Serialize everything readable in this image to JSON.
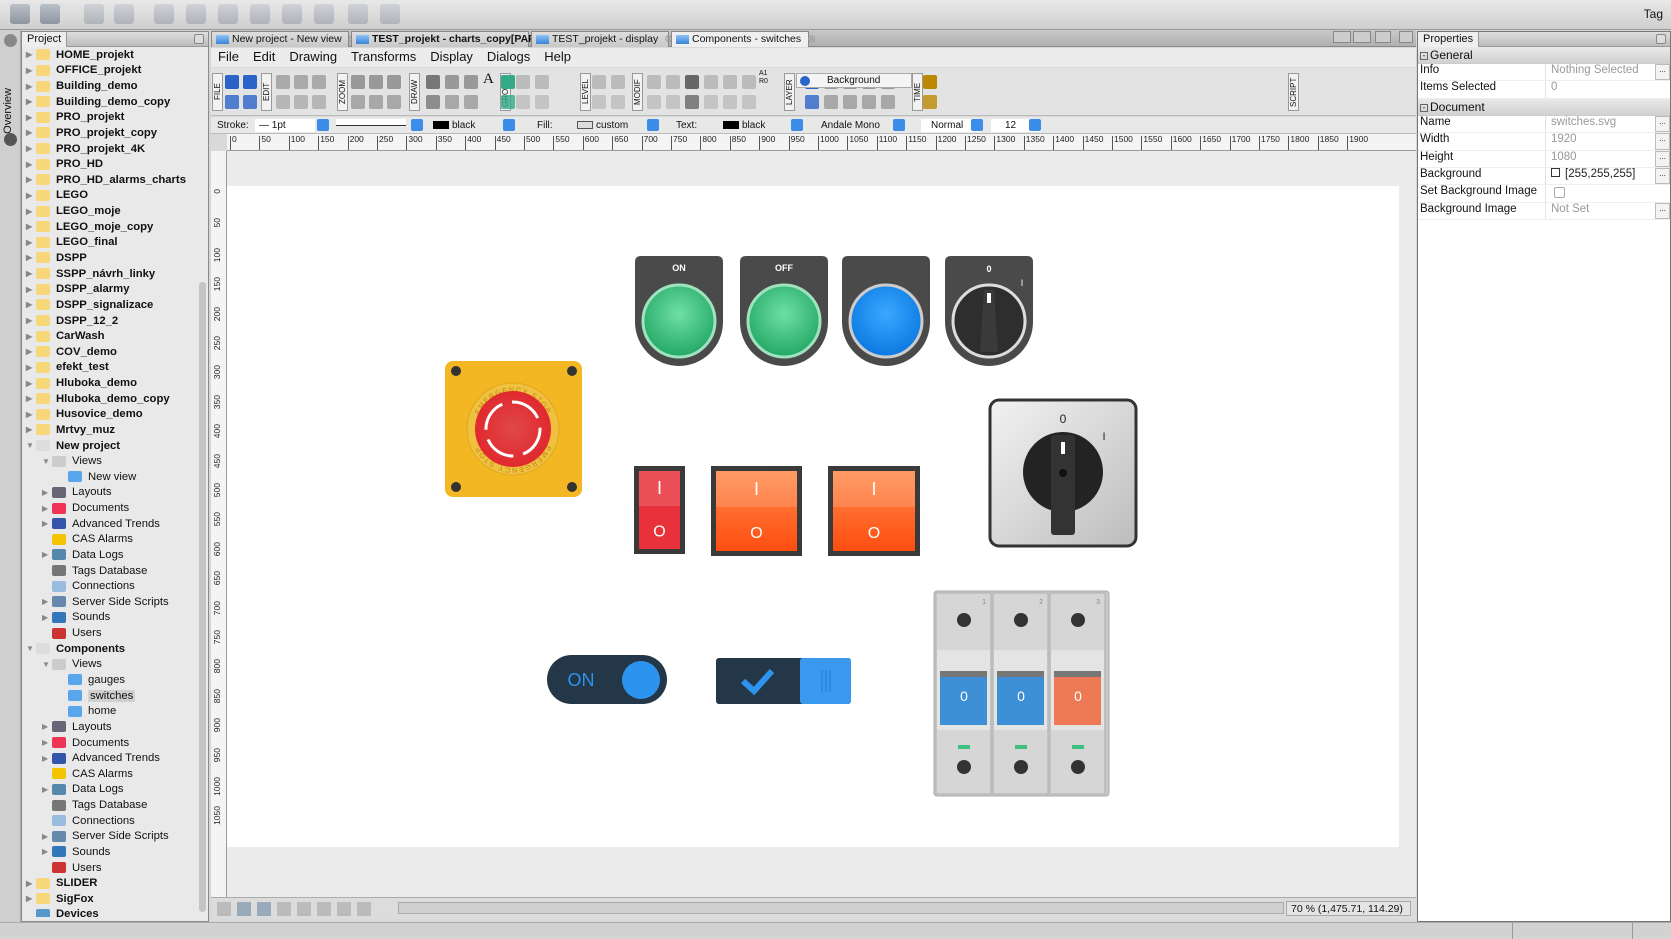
{
  "topbar": {
    "right_label": "Tag"
  },
  "left_strip": {
    "overview_label": "Overview"
  },
  "project_panel": {
    "tab": "Project",
    "items": [
      {
        "label": "HOME_projekt",
        "level": 0,
        "arrow": "right",
        "icon": "folder",
        "bold": true
      },
      {
        "label": "OFFICE_projekt",
        "level": 0,
        "arrow": "right",
        "icon": "folder",
        "bold": true
      },
      {
        "label": "Building_demo",
        "level": 0,
        "arrow": "right",
        "icon": "folder",
        "bold": true
      },
      {
        "label": "Building_demo_copy",
        "level": 0,
        "arrow": "right",
        "icon": "folder",
        "bold": true
      },
      {
        "label": "PRO_projekt",
        "level": 0,
        "arrow": "right",
        "icon": "folder",
        "bold": true
      },
      {
        "label": "PRO_projekt_copy",
        "level": 0,
        "arrow": "right",
        "icon": "folder",
        "bold": true
      },
      {
        "label": "PRO_projekt_4K",
        "level": 0,
        "arrow": "right",
        "icon": "folder",
        "bold": true
      },
      {
        "label": "PRO_HD",
        "level": 0,
        "arrow": "right",
        "icon": "folder",
        "bold": true
      },
      {
        "label": "PRO_HD_alarms_charts",
        "level": 0,
        "arrow": "right",
        "icon": "folder",
        "bold": true
      },
      {
        "label": "LEGO",
        "level": 0,
        "arrow": "right",
        "icon": "folder",
        "bold": true
      },
      {
        "label": "LEGO_moje",
        "level": 0,
        "arrow": "right",
        "icon": "folder",
        "bold": true
      },
      {
        "label": "LEGO_moje_copy",
        "level": 0,
        "arrow": "right",
        "icon": "folder",
        "bold": true
      },
      {
        "label": "LEGO_final",
        "level": 0,
        "arrow": "right",
        "icon": "folder",
        "bold": true
      },
      {
        "label": "DSPP",
        "level": 0,
        "arrow": "right",
        "icon": "folder",
        "bold": true
      },
      {
        "label": "SSPP_návrh_linky",
        "level": 0,
        "arrow": "right",
        "icon": "folder",
        "bold": true
      },
      {
        "label": "DSPP_alarmy",
        "level": 0,
        "arrow": "right",
        "icon": "folder",
        "bold": true
      },
      {
        "label": "DSPP_signalizace",
        "level": 0,
        "arrow": "right",
        "icon": "folder",
        "bold": true
      },
      {
        "label": "DSPP_12_2",
        "level": 0,
        "arrow": "right",
        "icon": "folder",
        "bold": true
      },
      {
        "label": "CarWash",
        "level": 0,
        "arrow": "right",
        "icon": "folder",
        "bold": true
      },
      {
        "label": "COV_demo",
        "level": 0,
        "arrow": "right",
        "icon": "folder",
        "bold": true
      },
      {
        "label": "efekt_test",
        "level": 0,
        "arrow": "right",
        "icon": "folder",
        "bold": true
      },
      {
        "label": "Hluboka_demo",
        "level": 0,
        "arrow": "right",
        "icon": "folder",
        "bold": true
      },
      {
        "label": "Hluboka_demo_copy",
        "level": 0,
        "arrow": "right",
        "icon": "folder",
        "bold": true
      },
      {
        "label": "Husovice_demo",
        "level": 0,
        "arrow": "right",
        "icon": "folder",
        "bold": true
      },
      {
        "label": "Mrtvy_muz",
        "level": 0,
        "arrow": "right",
        "icon": "folder",
        "bold": true
      },
      {
        "label": "New project",
        "level": 0,
        "arrow": "down",
        "icon": "folder-open",
        "bold": true
      },
      {
        "label": "Views",
        "level": 1,
        "arrow": "down",
        "icon": "views"
      },
      {
        "label": "New view",
        "level": 2,
        "arrow": "none",
        "icon": "monitor"
      },
      {
        "label": "Layouts",
        "level": 1,
        "arrow": "right",
        "icon": "layouts"
      },
      {
        "label": "Documents",
        "level": 1,
        "arrow": "right",
        "icon": "pdf"
      },
      {
        "label": "Advanced Trends",
        "level": 1,
        "arrow": "right",
        "icon": "trend"
      },
      {
        "label": "CAS Alarms",
        "level": 1,
        "arrow": "none",
        "icon": "bell"
      },
      {
        "label": "Data Logs",
        "level": 1,
        "arrow": "right",
        "icon": "datalog"
      },
      {
        "label": "Tags Database",
        "level": 1,
        "arrow": "none",
        "icon": "database"
      },
      {
        "label": "Connections",
        "level": 1,
        "arrow": "none",
        "icon": "link"
      },
      {
        "label": "Server Side Scripts",
        "level": 1,
        "arrow": "right",
        "icon": "script"
      },
      {
        "label": "Sounds",
        "level": 1,
        "arrow": "right",
        "icon": "speaker"
      },
      {
        "label": "Users",
        "level": 1,
        "arrow": "none",
        "icon": "users"
      },
      {
        "label": "Components",
        "level": 0,
        "arrow": "down",
        "icon": "folder-open",
        "bold": true
      },
      {
        "label": "Views",
        "level": 1,
        "arrow": "down",
        "icon": "views"
      },
      {
        "label": "gauges",
        "level": 2,
        "arrow": "none",
        "icon": "monitor"
      },
      {
        "label": "switches",
        "level": 2,
        "arrow": "none",
        "icon": "monitor",
        "selected": true
      },
      {
        "label": "home",
        "level": 2,
        "arrow": "none",
        "icon": "monitor"
      },
      {
        "label": "Layouts",
        "level": 1,
        "arrow": "right",
        "icon": "layouts"
      },
      {
        "label": "Documents",
        "level": 1,
        "arrow": "right",
        "icon": "pdf"
      },
      {
        "label": "Advanced Trends",
        "level": 1,
        "arrow": "right",
        "icon": "trend"
      },
      {
        "label": "CAS Alarms",
        "level": 1,
        "arrow": "none",
        "icon": "bell"
      },
      {
        "label": "Data Logs",
        "level": 1,
        "arrow": "right",
        "icon": "datalog"
      },
      {
        "label": "Tags Database",
        "level": 1,
        "arrow": "none",
        "icon": "database"
      },
      {
        "label": "Connections",
        "level": 1,
        "arrow": "none",
        "icon": "link"
      },
      {
        "label": "Server Side Scripts",
        "level": 1,
        "arrow": "right",
        "icon": "script"
      },
      {
        "label": "Sounds",
        "level": 1,
        "arrow": "right",
        "icon": "speaker"
      },
      {
        "label": "Users",
        "level": 1,
        "arrow": "none",
        "icon": "users"
      },
      {
        "label": "SLIDER",
        "level": 0,
        "arrow": "right",
        "icon": "folder",
        "bold": true
      },
      {
        "label": "SigFox",
        "level": 0,
        "arrow": "right",
        "icon": "folder",
        "bold": true
      },
      {
        "label": "Devices",
        "level": 0,
        "arrow": "none",
        "icon": "devices",
        "bold": true
      }
    ]
  },
  "doc_tabs": [
    {
      "label": "New project - New view",
      "bold": false
    },
    {
      "label": "TEST_projekt - charts_copy[PAR]",
      "bold": true
    },
    {
      "label": "TEST_projekt - display",
      "bold": false
    },
    {
      "label": "Components - switches",
      "bold": false,
      "active": true
    }
  ],
  "menu": [
    "File",
    "Edit",
    "Drawing",
    "Transforms",
    "Display",
    "Dialogs",
    "Help"
  ],
  "toolbar": {
    "groups": [
      "FILE",
      "EDIT",
      "ZOOM",
      "DRAW",
      "GROUP",
      "LEVEL",
      "MODIF",
      "LAYER",
      "TIME",
      "SCRIPT"
    ],
    "layer_select": "Background",
    "text_tool": "A",
    "ar_label": "A1 R0"
  },
  "format_bar": {
    "stroke_label": "Stroke:",
    "stroke_width": "1pt",
    "stroke_color": "black",
    "fill_label": "Fill:",
    "fill_value": "custom",
    "text_label": "Text:",
    "text_color": "black",
    "font": "Andale Mono",
    "style": "Normal",
    "size": "12"
  },
  "ruler": {
    "h_labels": [
      "0",
      "50",
      "100",
      "150",
      "200",
      "250",
      "300",
      "350",
      "400",
      "450",
      "500",
      "550",
      "600",
      "650",
      "700",
      "750",
      "800",
      "850",
      "900",
      "950",
      "1000",
      "1050",
      "1100",
      "1150",
      "1200",
      "1250",
      "1300",
      "1350",
      "1400",
      "1450",
      "1500",
      "1550",
      "1600",
      "1650",
      "1700",
      "1750",
      "1800",
      "1850",
      "1900"
    ],
    "v_labels": [
      "0",
      "50",
      "100",
      "150",
      "200",
      "250",
      "300",
      "350",
      "400",
      "450",
      "500",
      "550",
      "600",
      "650",
      "700",
      "750",
      "800",
      "850",
      "900",
      "950",
      "1000",
      "1050"
    ]
  },
  "canvas": {
    "estop_text": "EMERGENCY STOP",
    "pushbuttons": [
      {
        "label": "ON",
        "color": "#3dbb7a"
      },
      {
        "label": "OFF",
        "color": "#3dbb7a"
      },
      {
        "label": "",
        "color": "#1e8ff0"
      }
    ],
    "selector_small": {
      "left": "0",
      "right": "I"
    },
    "rockers": [
      {
        "on": "I",
        "off": "O",
        "color": "#e8313a"
      },
      {
        "on": "I",
        "off": "O",
        "color": "#ff5a1a"
      },
      {
        "on": "I",
        "off": "O",
        "color": "#ff5a1a"
      }
    ],
    "rotary": {
      "left": "0",
      "right": "I"
    },
    "toggle_on": {
      "label": "ON",
      "state": "on"
    },
    "check_toggle": {
      "state": "checked"
    },
    "breakers": [
      {
        "num": "1",
        "label": "0",
        "color": "#3d8fd6"
      },
      {
        "num": "2",
        "label": "0",
        "color": "#3d8fd6"
      },
      {
        "num": "3",
        "label": "0",
        "color": "#ee7a55"
      }
    ]
  },
  "status": {
    "zoom_readout": "70 % (1,475.71, 114.29)"
  },
  "properties": {
    "tab": "Properties",
    "general_label": "General",
    "general": [
      {
        "key": "Info",
        "value": "Nothing Selected",
        "button": true
      },
      {
        "key": "Items Selected",
        "value": "0"
      }
    ],
    "document_label": "Document",
    "document": [
      {
        "key": "Name",
        "value": "switches.svg",
        "button": true
      },
      {
        "key": "Width",
        "value": "1920",
        "button": true
      },
      {
        "key": "Height",
        "value": "1080",
        "button": true
      },
      {
        "key": "Background",
        "value": "[255,255,255]",
        "button": true,
        "swatch": true
      },
      {
        "key": "Set Background Image",
        "value": "",
        "checkbox": true
      },
      {
        "key": "Background Image",
        "value": "Not Set",
        "button": true
      }
    ]
  }
}
